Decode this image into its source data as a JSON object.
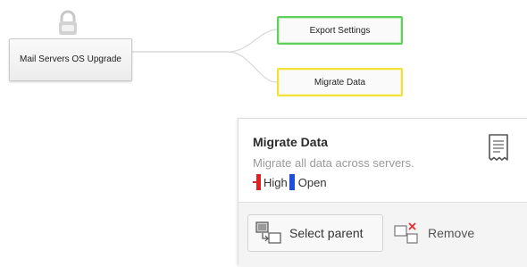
{
  "mindmap": {
    "root": {
      "label": "Mail Servers OS Upgrade",
      "locked": true
    },
    "children": [
      {
        "label": "Export Settings",
        "color": "#5fd15a"
      },
      {
        "label": "Migrate Data",
        "color": "#f0e23a"
      }
    ]
  },
  "details_card": {
    "title": "Migrate Data",
    "description": "Migrate all data across servers.",
    "priority": {
      "label": "High",
      "color": "#e02020"
    },
    "status": {
      "label": "Open",
      "color": "#1f4fd8"
    },
    "icon": "document-icon",
    "actions": {
      "select_parent_label": "Select parent",
      "remove_label": "Remove"
    }
  }
}
